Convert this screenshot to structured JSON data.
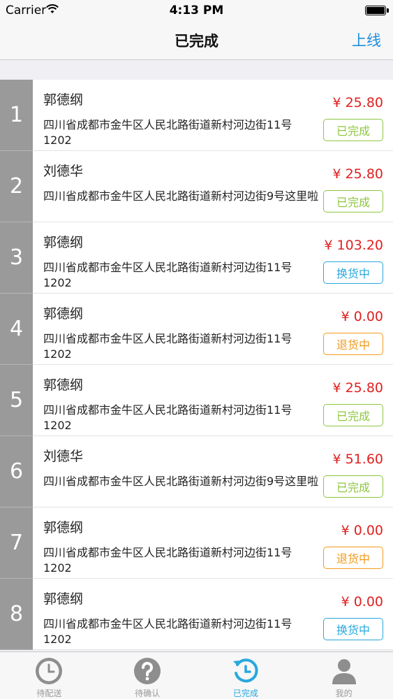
{
  "status_bar": {
    "carrier": "Carrier",
    "time": "4:13 PM"
  },
  "nav": {
    "title": "已完成",
    "action": "上线"
  },
  "orders": [
    {
      "index": "1",
      "name": "郭德纲",
      "address": "四川省成都市金牛区人民北路街道新村河边街11号1202",
      "price": "¥ 25.80",
      "status": "已完成",
      "status_type": "done"
    },
    {
      "index": "2",
      "name": "刘德华",
      "address": "四川省成都市金牛区人民北路街道新村河边街9号这里啦",
      "price": "¥ 25.80",
      "status": "已完成",
      "status_type": "done"
    },
    {
      "index": "3",
      "name": "郭德纲",
      "address": "四川省成都市金牛区人民北路街道新村河边街11号1202",
      "price": "¥ 103.20",
      "status": "换货中",
      "status_type": "exchange"
    },
    {
      "index": "4",
      "name": "郭德纲",
      "address": "四川省成都市金牛区人民北路街道新村河边街11号1202",
      "price": "¥ 0.00",
      "status": "退货中",
      "status_type": "return"
    },
    {
      "index": "5",
      "name": "郭德纲",
      "address": "四川省成都市金牛区人民北路街道新村河边街11号1202",
      "price": "¥ 25.80",
      "status": "已完成",
      "status_type": "done"
    },
    {
      "index": "6",
      "name": "刘德华",
      "address": "四川省成都市金牛区人民北路街道新村河边街9号这里啦",
      "price": "¥ 51.60",
      "status": "已完成",
      "status_type": "done"
    },
    {
      "index": "7",
      "name": "郭德纲",
      "address": "四川省成都市金牛区人民北路街道新村河边街11号1202",
      "price": "¥ 0.00",
      "status": "退货中",
      "status_type": "return"
    },
    {
      "index": "8",
      "name": "郭德纲",
      "address": "四川省成都市金牛区人民北路街道新村河边街11号1202",
      "price": "¥ 0.00",
      "status": "换货中",
      "status_type": "exchange"
    }
  ],
  "tabs": [
    {
      "label": "待配送",
      "icon": "clock-icon"
    },
    {
      "label": "待确认",
      "icon": "question-icon"
    },
    {
      "label": "已完成",
      "icon": "history-icon",
      "active": true
    },
    {
      "label": "我的",
      "icon": "user-icon"
    }
  ],
  "colors": {
    "accent": "#29a8dd",
    "price": "#e02020",
    "status_done": "#8cc63f",
    "status_exchange": "#29a8dd",
    "status_return": "#f29a1c",
    "index_bg": "#9a9a9a"
  }
}
